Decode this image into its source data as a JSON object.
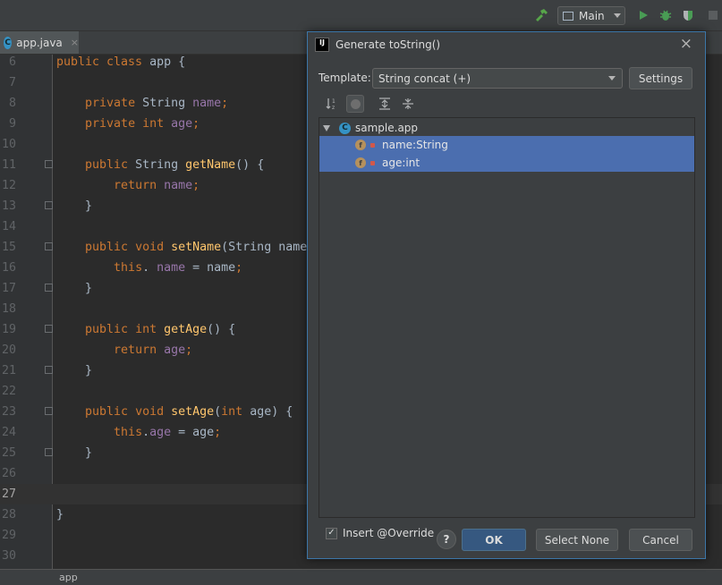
{
  "toolbar": {
    "run_config": "Main",
    "colors": {
      "build": "#57a64a",
      "run": "#499c54",
      "debug": "#499c54"
    }
  },
  "editor": {
    "tab": {
      "icon_letter": "C",
      "label": "app.java",
      "close": "×"
    },
    "lines": [
      {
        "n": "6",
        "current": false,
        "fold": false,
        "tokens": [
          [
            "kw",
            "public class "
          ],
          [
            "",
            "app {"
          ]
        ]
      },
      {
        "n": "7",
        "current": false,
        "fold": false,
        "tokens": []
      },
      {
        "n": "8",
        "current": false,
        "fold": false,
        "tokens": [
          [
            "",
            "    "
          ],
          [
            "kw",
            "private "
          ],
          [
            "",
            "String "
          ],
          [
            "fld",
            "name"
          ],
          [
            "kw",
            ";"
          ]
        ]
      },
      {
        "n": "9",
        "current": false,
        "fold": false,
        "tokens": [
          [
            "",
            "    "
          ],
          [
            "kw",
            "private int "
          ],
          [
            "fld",
            "age"
          ],
          [
            "kw",
            ";"
          ]
        ]
      },
      {
        "n": "10",
        "current": false,
        "fold": false,
        "tokens": []
      },
      {
        "n": "11",
        "current": false,
        "fold": true,
        "tokens": [
          [
            "",
            "    "
          ],
          [
            "kw",
            "public "
          ],
          [
            "",
            "String "
          ],
          [
            "fn",
            "getName"
          ],
          [
            "",
            "() {"
          ]
        ]
      },
      {
        "n": "12",
        "current": false,
        "fold": false,
        "tokens": [
          [
            "",
            "        "
          ],
          [
            "kw",
            "return "
          ],
          [
            "fld",
            "name"
          ],
          [
            "kw",
            ";"
          ]
        ]
      },
      {
        "n": "13",
        "current": false,
        "fold": true,
        "tokens": [
          [
            "",
            "    }"
          ]
        ]
      },
      {
        "n": "14",
        "current": false,
        "fold": false,
        "tokens": []
      },
      {
        "n": "15",
        "current": false,
        "fold": true,
        "tokens": [
          [
            "",
            "    "
          ],
          [
            "kw",
            "public void "
          ],
          [
            "fn",
            "setName"
          ],
          [
            "",
            "(String name"
          ]
        ]
      },
      {
        "n": "16",
        "current": false,
        "fold": false,
        "tokens": [
          [
            "",
            "        "
          ],
          [
            "kw",
            "this"
          ],
          [
            "",
            ". "
          ],
          [
            "fld",
            "name"
          ],
          [
            "",
            " = name"
          ],
          [
            "kw",
            ";"
          ]
        ]
      },
      {
        "n": "17",
        "current": false,
        "fold": true,
        "tokens": [
          [
            "",
            "    }"
          ]
        ]
      },
      {
        "n": "18",
        "current": false,
        "fold": false,
        "tokens": []
      },
      {
        "n": "19",
        "current": false,
        "fold": true,
        "tokens": [
          [
            "",
            "    "
          ],
          [
            "kw",
            "public int "
          ],
          [
            "fn",
            "getAge"
          ],
          [
            "",
            "() {"
          ]
        ]
      },
      {
        "n": "20",
        "current": false,
        "fold": false,
        "tokens": [
          [
            "",
            "        "
          ],
          [
            "kw",
            "return "
          ],
          [
            "fld",
            "age"
          ],
          [
            "kw",
            ";"
          ]
        ]
      },
      {
        "n": "21",
        "current": false,
        "fold": true,
        "tokens": [
          [
            "",
            "    }"
          ]
        ]
      },
      {
        "n": "22",
        "current": false,
        "fold": false,
        "tokens": []
      },
      {
        "n": "23",
        "current": false,
        "fold": true,
        "tokens": [
          [
            "",
            "    "
          ],
          [
            "kw",
            "public void "
          ],
          [
            "fn",
            "setAge"
          ],
          [
            "",
            "("
          ],
          [
            "kw",
            "int "
          ],
          [
            "",
            "age) {"
          ]
        ]
      },
      {
        "n": "24",
        "current": false,
        "fold": false,
        "tokens": [
          [
            "",
            "        "
          ],
          [
            "kw",
            "this"
          ],
          [
            "",
            "."
          ],
          [
            "fld",
            "age"
          ],
          [
            "",
            " = age"
          ],
          [
            "kw",
            ";"
          ]
        ]
      },
      {
        "n": "25",
        "current": false,
        "fold": true,
        "tokens": [
          [
            "",
            "    }"
          ]
        ]
      },
      {
        "n": "26",
        "current": false,
        "fold": false,
        "tokens": []
      },
      {
        "n": "27",
        "current": true,
        "fold": false,
        "tokens": []
      },
      {
        "n": "28",
        "current": false,
        "fold": false,
        "tokens": [
          [
            "",
            "}"
          ]
        ]
      },
      {
        "n": "29",
        "current": false,
        "fold": false,
        "tokens": []
      },
      {
        "n": "30",
        "current": false,
        "fold": false,
        "tokens": []
      }
    ],
    "status": "app"
  },
  "dialog": {
    "logo": "IJ",
    "title": "Generate toString()",
    "close": "×",
    "template_label": "Template:",
    "template_value": "String concat (+)",
    "settings_button": "Settings",
    "tree": {
      "root_icon_letter": "C",
      "root_label": "sample.app",
      "members": [
        {
          "icon_letter": "f",
          "label": "name:String",
          "selected": true
        },
        {
          "icon_letter": "f",
          "label": "age:int",
          "selected": true
        }
      ]
    },
    "insert_override": {
      "label": "Insert @Override",
      "checked": true,
      "mark": "✓"
    },
    "help": "?",
    "ok_button": "OK",
    "select_none_button": "Select None",
    "cancel_button": "Cancel"
  }
}
